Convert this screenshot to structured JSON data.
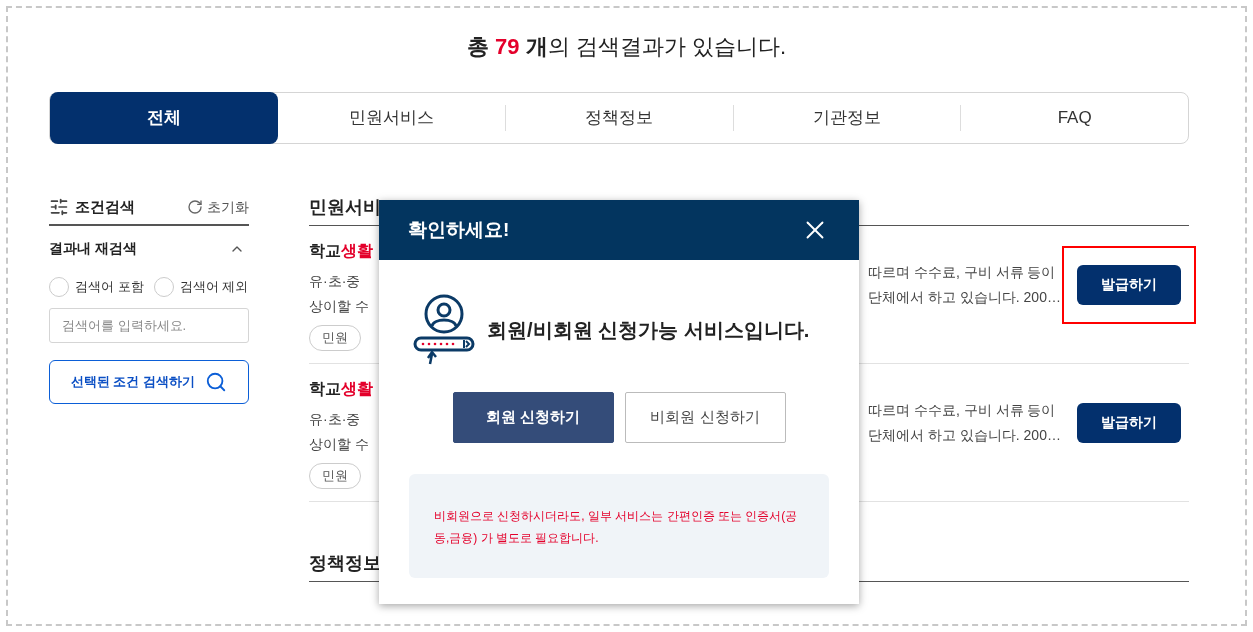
{
  "summary": {
    "prefix": "총",
    "count": "79",
    "unit": "개",
    "suffix": "의 검색결과가 있습니다."
  },
  "tabs": [
    {
      "label": "전체",
      "selected": true
    },
    {
      "label": "민원서비스",
      "selected": false
    },
    {
      "label": "정책정보",
      "selected": false
    },
    {
      "label": "기관정보",
      "selected": false
    },
    {
      "label": "FAQ",
      "selected": false
    }
  ],
  "sidebar": {
    "title": "조건검색",
    "reset": "초기화",
    "refine_title": "결과내 재검색",
    "expanded": true,
    "options": [
      {
        "label": "검색어 포함",
        "selected": false
      },
      {
        "label": "검색어 제외",
        "selected": false
      }
    ],
    "search": {
      "placeholder": "검색어를 입력하세요."
    },
    "submit": "선택된 조건 검색하기"
  },
  "sections": [
    {
      "heading": "민원서비",
      "results": [
        {
          "title": "학교",
          "highlight": "생활",
          "lines_left": [
            "유·초·중",
            "상이할 수"
          ],
          "lines_right": [
            "따르며 수수료, 구비 서류 등이",
            "단체에서 하고 있습니다. 200…"
          ],
          "tag": "민원",
          "button": "발급하기",
          "marked": true
        },
        {
          "title": "학교",
          "highlight": "생활",
          "lines_left": [
            "유·초·중",
            "상이할 수"
          ],
          "lines_right": [
            "따르며 수수료, 구비 서류 등이",
            "단체에서 하고 있습니다. 200…"
          ],
          "tag": "민원",
          "button": "발급하기",
          "marked": false
        }
      ]
    },
    {
      "heading": "정책정보"
    }
  ],
  "modal": {
    "title": "확인하세요!",
    "message": "회원/비회원 신청가능 서비스입니다.",
    "buttons": [
      {
        "label": "회원 신청하기",
        "kind": "primary"
      },
      {
        "label": "비회원 신청하기",
        "kind": "secondary"
      }
    ],
    "notice": "비회원으로 신청하시더라도, 일부 서비스는 간편인증 또는 인증서(공동,금융) 가 별도로 필요합니다."
  }
}
